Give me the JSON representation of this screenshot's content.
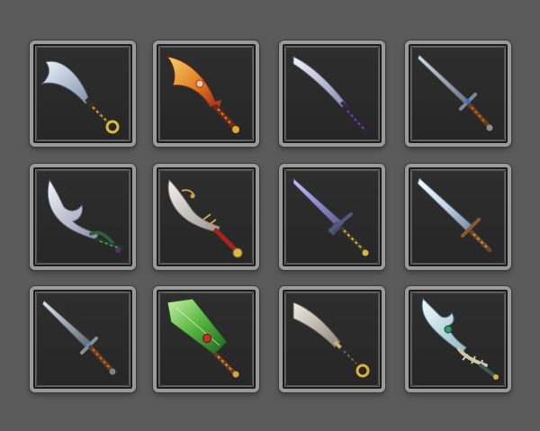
{
  "inventory": {
    "slots": [
      {
        "item": "curved-steel-blade-icon",
        "blade_color": "#b9c8d8"
      },
      {
        "item": "flame-scimitar-icon",
        "blade_color": "#e2772a"
      },
      {
        "item": "katana-icon",
        "blade_color": "#c9cbe0"
      },
      {
        "item": "longsword-icon",
        "blade_color": "#9aa3ad"
      },
      {
        "item": "serrated-scythe-blade-icon",
        "blade_color": "#c7c9d6"
      },
      {
        "item": "ornate-saber-icon",
        "blade_color": "#d7d3cf"
      },
      {
        "item": "violet-broadsword-icon",
        "blade_color": "#8f86c8"
      },
      {
        "item": "crystal-sword-icon",
        "blade_color": "#c9d7e6"
      },
      {
        "item": "dagger-icon",
        "blade_color": "#a7adb5"
      },
      {
        "item": "emerald-cleaver-icon",
        "blade_color": "#4caf3c"
      },
      {
        "item": "machete-icon",
        "blade_color": "#c8c2b8"
      },
      {
        "item": "jade-wave-blade-icon",
        "blade_color": "#bfe0e4"
      }
    ]
  },
  "colors": {
    "background": "#5a5a5a",
    "slot_fill": "#2a2a2a",
    "slot_frame": "#9a9a9a"
  }
}
